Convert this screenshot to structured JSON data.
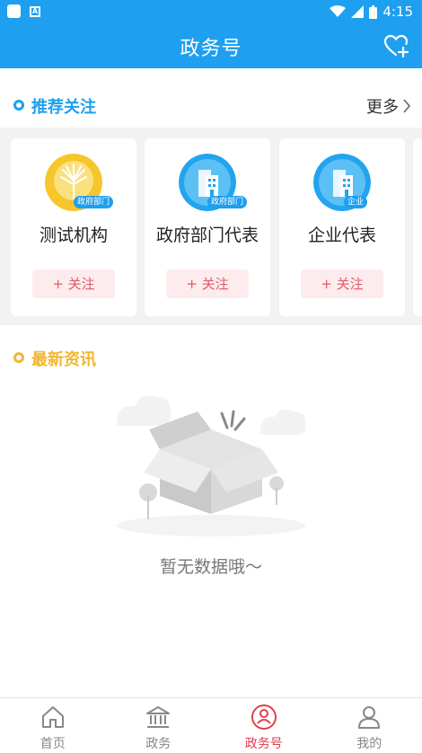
{
  "status_bar": {
    "time": "4:15"
  },
  "header": {
    "title": "政务号"
  },
  "recommend": {
    "title": "推荐关注",
    "more_label": "更多",
    "cards": [
      {
        "name": "测试机构",
        "tag": "政府部门",
        "follow": "+ 关注",
        "icon": "tree-logo-icon"
      },
      {
        "name": "政府部门代表",
        "tag": "政府部门",
        "follow": "+ 关注",
        "icon": "building-icon"
      },
      {
        "name": "企业代表",
        "tag": "企业",
        "follow": "+ 关注",
        "icon": "building-icon"
      }
    ]
  },
  "news": {
    "title": "最新资讯",
    "empty_text": "暂无数据哦～"
  },
  "colors": {
    "primary": "#1e9fef",
    "accent_red": "#e0404e",
    "news_yellow": "#f2b632"
  },
  "nav": {
    "items": [
      {
        "label": "首页",
        "icon": "home-icon"
      },
      {
        "label": "政务",
        "icon": "government-icon"
      },
      {
        "label": "政务号",
        "icon": "gov-account-icon"
      },
      {
        "label": "我的",
        "icon": "user-icon"
      }
    ]
  }
}
